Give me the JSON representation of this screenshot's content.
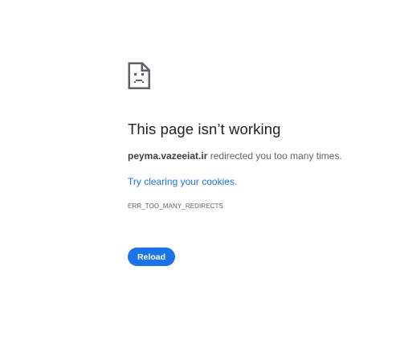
{
  "error": {
    "icon": "sad-page-icon",
    "title": "This page isn’t working",
    "host": "peyma.vazeeiat.ir",
    "summary_rest": " redirected you too many times.",
    "suggestion_link": "Try clearing your cookies.",
    "error_code": "ERR_TOO_MANY_REDIRECTS"
  },
  "actions": {
    "reload_label": "Reload"
  },
  "colors": {
    "accent": "#1a73e8",
    "title_text": "#202124",
    "body_text": "#5f6368",
    "icon": "#5f6368"
  }
}
